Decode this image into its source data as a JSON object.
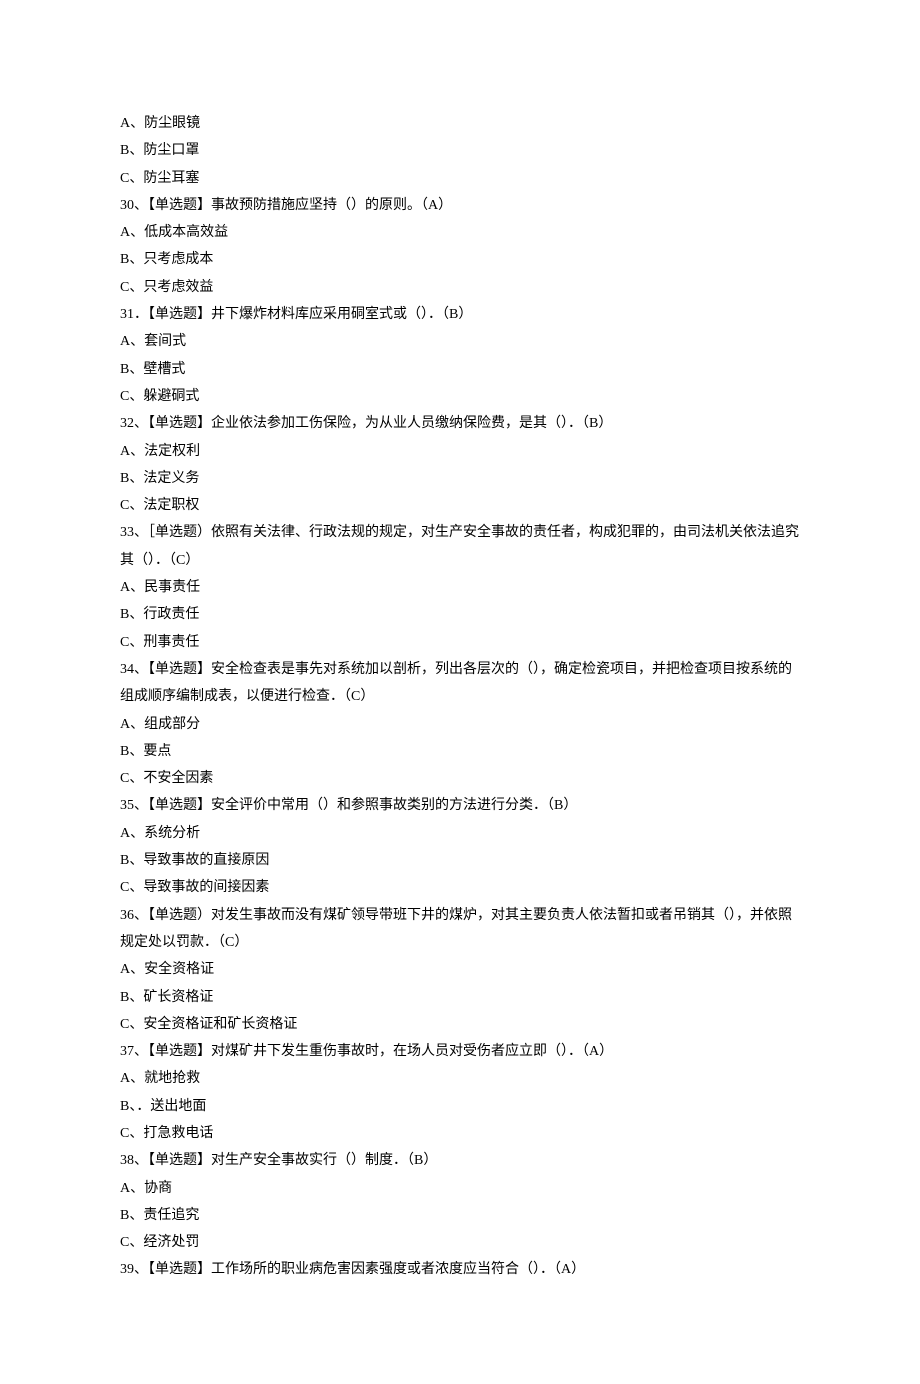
{
  "lines": [
    "A、防尘眼镜",
    "B、防尘口罩",
    "C、防尘耳塞",
    "30、【单选题】事故预防措施应坚持（）的原则。（A）",
    "A、低成本高效益",
    "B、只考虑成本",
    "C、只考虑效益",
    "31．【单选题】井下爆炸材料库应采用硐室式或（）．（B）",
    "A、套间式",
    "B、壁槽式",
    "C、躲避硐式",
    "32、【单选题】企业依法参加工伤保险，为从业人员缴纳保险费，是其（）．（B）",
    "A、法定权利",
    "B、法定义务",
    "C、法定职权",
    "33、［单选题）依照有关法律、行政法规的规定，对生产安全事故的责任者，构成犯罪的，由司法机关依法追究其（）．（C）",
    "A、民事责任",
    "B、行政责任",
    "C、刑事责任",
    "34、【单选题】安全检查表是事先对系统加以剖析，列出各层次的（），确定检瓷项目，并把检查项目按系统的组成顺序编制成表，以便进行检查．（C）",
    "A、组成部分",
    "B、要点",
    "C、不安全因素",
    "35、【单选题】安全评价中常用（）和参照事故类别的方法进行分类．（B）",
    "A、系统分析",
    "B、导致事故的直接原因",
    "C、导致事故的间接因素",
    "36、【单选题）对发生事故而没有煤矿领导带班下井的煤炉，对其主要负责人依法暂扣或者吊销其（），并依照规定处以罚款．（C）",
    "A、安全资格证",
    "B、矿长资格证",
    "C、安全资格证和矿长资格证",
    "37、【单选题】对煤矿井下发生重伤事故时，在场人员对受伤者应立即（）．（A）",
    "A、就地抢救",
    "B、．送出地面",
    "C、打急救电话",
    "38、【单选题】对生产安全事故实行（）制度．（B）",
    "A、协商",
    "B、责任追究",
    "C、经济处罚",
    "39、【单选题】工作场所的职业病危害因素强度或者浓度应当符合（）．（A）"
  ]
}
